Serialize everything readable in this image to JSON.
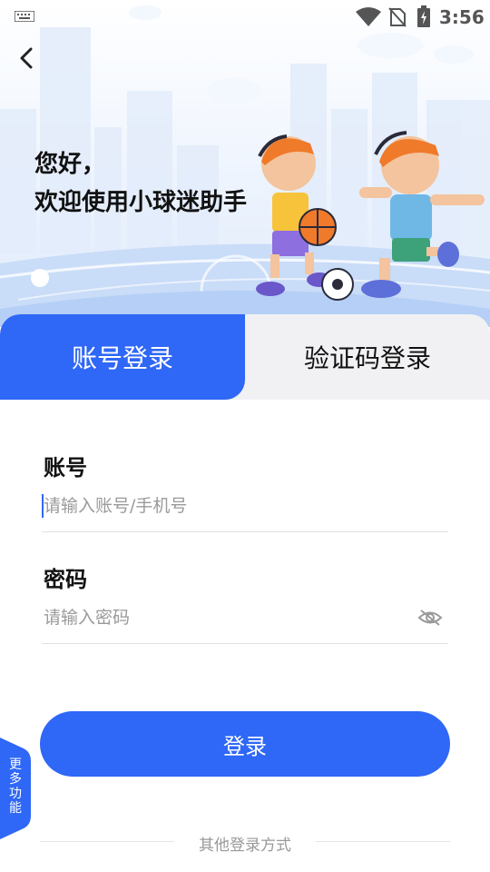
{
  "status_bar": {
    "time": "3:56"
  },
  "greeting": {
    "line1": "您好，",
    "line2": "欢迎使用小球迷助手"
  },
  "tabs": [
    {
      "label": "账号登录",
      "active": true
    },
    {
      "label": "验证码登录",
      "active": false
    }
  ],
  "form": {
    "account_label": "账号",
    "account_placeholder": "请输入账号/手机号",
    "password_label": "密码",
    "password_placeholder": "请输入密码"
  },
  "login_button": "登录",
  "other_login": "其他登录方式",
  "more_features": [
    "更",
    "多",
    "功",
    "能"
  ],
  "colors": {
    "accent": "#2f67f6",
    "tab_inactive_bg": "#f1f1f4",
    "ball": "#ef7a2a"
  }
}
